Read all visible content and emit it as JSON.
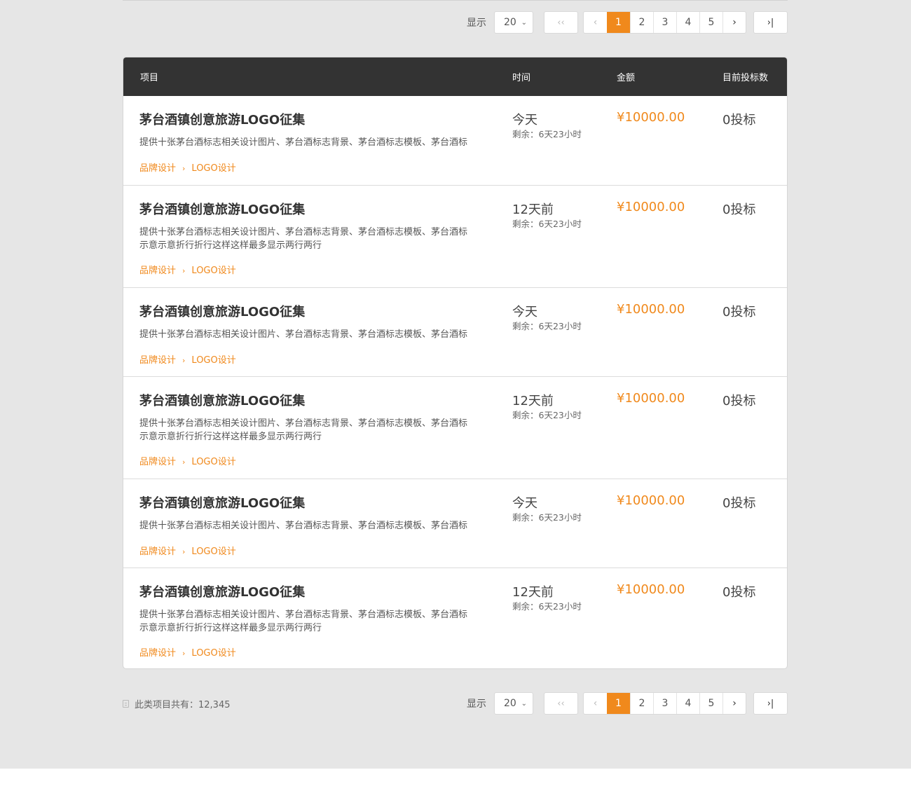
{
  "colors": {
    "accent": "#f0891c",
    "header_bg": "#333333",
    "page_bg": "#e6e6e6"
  },
  "pagination": {
    "show_label": "显示",
    "page_size": "20",
    "first_icon": "double-chevron-left-icon",
    "prev_icon": "chevron-left-icon",
    "next_icon": "chevron-right-icon",
    "last_icon": "skip-to-end-icon",
    "pages": [
      "1",
      "2",
      "3",
      "4",
      "5"
    ],
    "current_page": "1"
  },
  "table": {
    "headers": {
      "project": "项目",
      "time": "时间",
      "amount": "金额",
      "bids": "目前投标数"
    },
    "rows": [
      {
        "title": "茅台酒镇创意旅游LOGO征集",
        "desc": "提供十张茅台酒标志相关设计图片、茅台酒标志背景、茅台酒标志模板、茅台酒标",
        "cat1": "品牌设计",
        "cat2": "LOGO设计",
        "time": "今天",
        "remain": "剩余：6天23小时",
        "amount": "¥10000.00",
        "bids": "0投标"
      },
      {
        "title": "茅台酒镇创意旅游LOGO征集",
        "desc": "提供十张茅台酒标志相关设计图片、茅台酒标志背景、茅台酒标志模板、茅台酒标示意示意折行折行这样这样最多显示两行两行",
        "cat1": "品牌设计",
        "cat2": "LOGO设计",
        "time": "12天前",
        "remain": "剩余：6天23小时",
        "amount": "¥10000.00",
        "bids": "0投标"
      },
      {
        "title": "茅台酒镇创意旅游LOGO征集",
        "desc": "提供十张茅台酒标志相关设计图片、茅台酒标志背景、茅台酒标志模板、茅台酒标",
        "cat1": "品牌设计",
        "cat2": "LOGO设计",
        "time": "今天",
        "remain": "剩余：6天23小时",
        "amount": "¥10000.00",
        "bids": "0投标"
      },
      {
        "title": "茅台酒镇创意旅游LOGO征集",
        "desc": "提供十张茅台酒标志相关设计图片、茅台酒标志背景、茅台酒标志模板、茅台酒标示意示意折行折行这样这样最多显示两行两行",
        "cat1": "品牌设计",
        "cat2": "LOGO设计",
        "time": "12天前",
        "remain": "剩余：6天23小时",
        "amount": "¥10000.00",
        "bids": "0投标"
      },
      {
        "title": "茅台酒镇创意旅游LOGO征集",
        "desc": "提供十张茅台酒标志相关设计图片、茅台酒标志背景、茅台酒标志模板、茅台酒标",
        "cat1": "品牌设计",
        "cat2": "LOGO设计",
        "time": "今天",
        "remain": "剩余：6天23小时",
        "amount": "¥10000.00",
        "bids": "0投标"
      },
      {
        "title": "茅台酒镇创意旅游LOGO征集",
        "desc": "提供十张茅台酒标志相关设计图片、茅台酒标志背景、茅台酒标志模板、茅台酒标示意示意折行折行这样这样最多显示两行两行",
        "cat1": "品牌设计",
        "cat2": "LOGO设计",
        "time": "12天前",
        "remain": "剩余：6天23小时",
        "amount": "¥10000.00",
        "bids": "0投标"
      }
    ]
  },
  "footer": {
    "total_label": "此类项目共有：12,345"
  }
}
